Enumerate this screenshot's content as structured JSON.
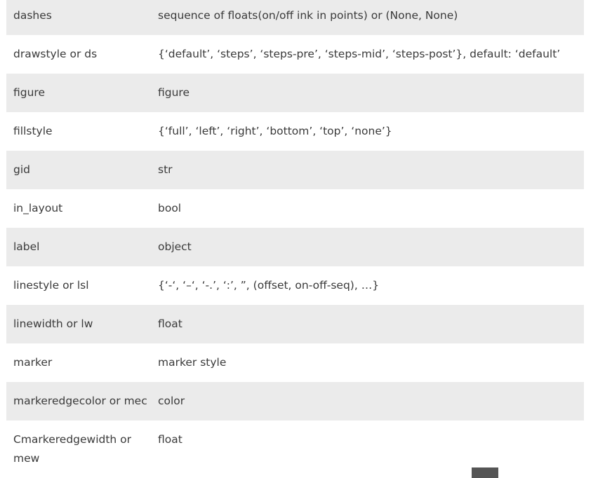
{
  "rows": [
    {
      "key": "dashes",
      "value": "sequence of floats(on/off ink in points) or (None, None)"
    },
    {
      "key": "drawstyle or ds",
      "value": "{‘default’, ‘steps’, ‘steps-pre’, ‘steps-mid’, ‘steps-post’}, default: ‘default’"
    },
    {
      "key": "figure",
      "value": "figure"
    },
    {
      "key": "fillstyle",
      "value": "{‘full’, ‘left’, ‘right’, ‘bottom’, ‘top’, ‘none’}"
    },
    {
      "key": "gid",
      "value": "str"
    },
    {
      "key": "in_layout",
      "value": "bool"
    },
    {
      "key": "label",
      "value": "object"
    },
    {
      "key": "linestyle or lsl",
      "value": "{‘-‘, ‘–‘, ‘-.’, ‘:’, ”, (offset, on-off-seq), …}"
    },
    {
      "key": "linewidth or lw",
      "value": "float"
    },
    {
      "key": "marker",
      "value": "marker style"
    },
    {
      "key": "markeredgecolor or mec",
      "value": "color"
    },
    {
      "key": "Cmarkeredgewidth or mew",
      "value": "float"
    }
  ]
}
